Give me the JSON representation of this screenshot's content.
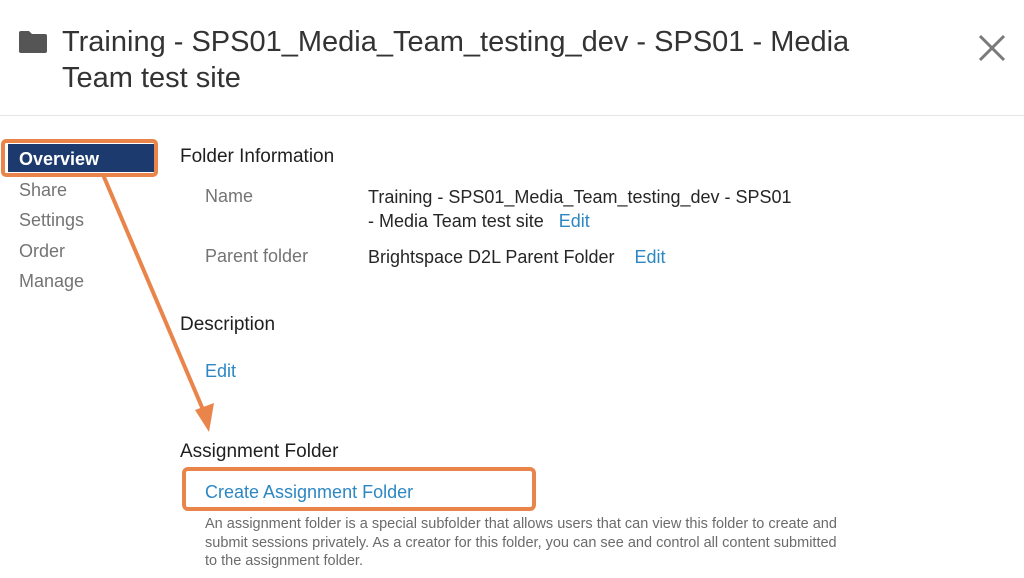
{
  "header": {
    "title": "Training - SPS01_Media_Team_testing_dev - SPS01 - Media Team test site",
    "folder_icon": "folder-icon",
    "close_icon": "close-icon"
  },
  "sidenav": {
    "items": [
      {
        "label": "Overview",
        "active": true
      },
      {
        "label": "Share",
        "active": false
      },
      {
        "label": "Settings",
        "active": false
      },
      {
        "label": "Order",
        "active": false
      },
      {
        "label": "Manage",
        "active": false
      }
    ]
  },
  "folder_info": {
    "heading": "Folder Information",
    "name_label": "Name",
    "name_value_line1": "Training - SPS01_Media_Team_testing_dev - SPS01",
    "name_value_line2": "- Media Team test site",
    "name_edit": "Edit",
    "parent_label": "Parent folder",
    "parent_value": "Brightspace D2L Parent Folder",
    "parent_edit": "Edit"
  },
  "description": {
    "heading": "Description",
    "edit": "Edit"
  },
  "assignment": {
    "heading": "Assignment Folder",
    "create_link": "Create Assignment Folder",
    "help_text": "An assignment folder is a special subfolder that allows users that can view this folder to create and submit sessions privately. As a creator for this folder, you can see and control all content submitted to the assignment folder."
  },
  "colors": {
    "accent_link": "#2c87c3",
    "nav_active_bg": "#1d3a6e",
    "annotation_orange": "#e9854a"
  }
}
